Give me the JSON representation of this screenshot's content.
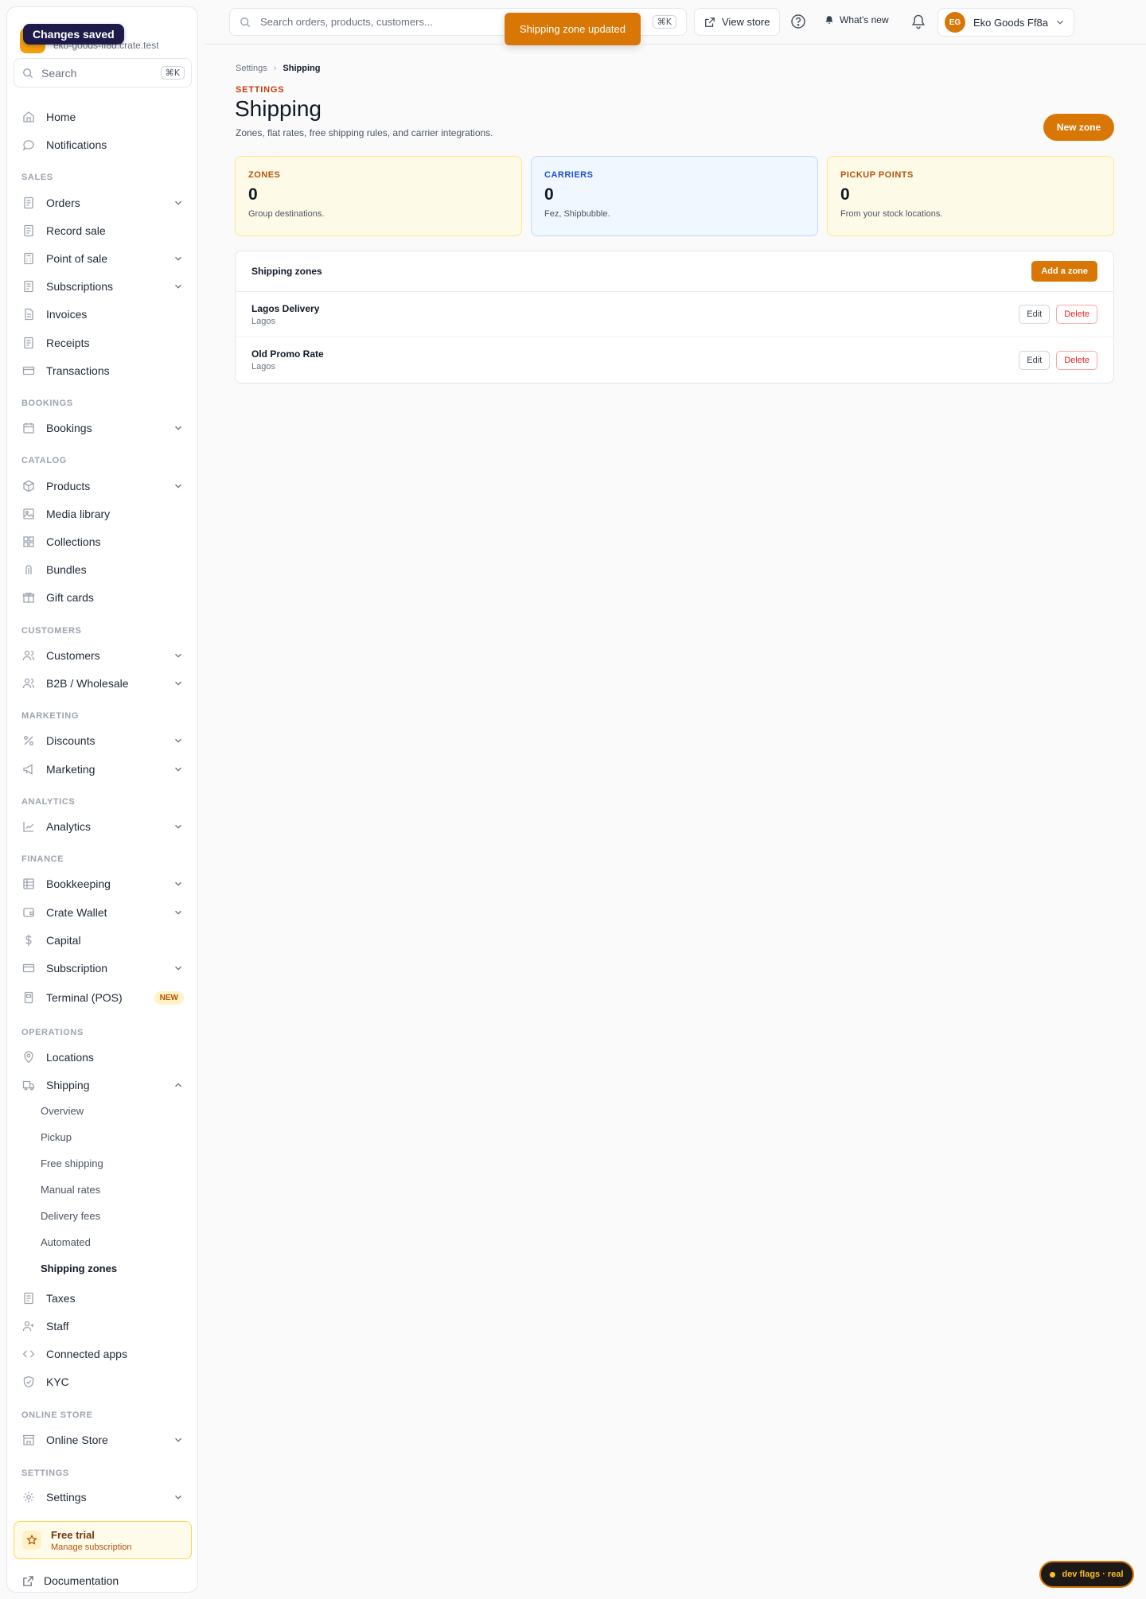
{
  "toasts": {
    "changes_saved": "Changes saved",
    "zone_updated": "Shipping zone updated"
  },
  "brand": {
    "url": "eko-goods-ff8d.crate.test"
  },
  "sidebar": {
    "search": {
      "label": "Search",
      "shortcut": "⌘K"
    },
    "items": {
      "home": "Home",
      "notifications": "Notifications",
      "orders": "Orders",
      "record_sale": "Record sale",
      "point_of_sale": "Point of sale",
      "subscriptions": "Subscriptions",
      "invoices": "Invoices",
      "receipts": "Receipts",
      "transactions": "Transactions",
      "bookings": "Bookings",
      "products": "Products",
      "media_library": "Media library",
      "collections": "Collections",
      "bundles": "Bundles",
      "gift_cards": "Gift cards",
      "customers": "Customers",
      "b2b": "B2B / Wholesale",
      "discounts": "Discounts",
      "marketing": "Marketing",
      "analytics": "Analytics",
      "bookkeeping": "Bookkeeping",
      "crate_wallet": "Crate Wallet",
      "capital": "Capital",
      "subscription": "Subscription",
      "terminal": "Terminal (POS)",
      "locations": "Locations",
      "shipping": "Shipping",
      "taxes": "Taxes",
      "staff": "Staff",
      "connected_apps": "Connected apps",
      "kyc": "KYC",
      "online_store": "Online Store",
      "settings": "Settings"
    },
    "sections": {
      "sales": "SALES",
      "bookings": "BOOKINGS",
      "catalog": "CATALOG",
      "customers": "CUSTOMERS",
      "marketing": "MARKETING",
      "analytics": "ANALYTICS",
      "finance": "FINANCE",
      "operations": "OPERATIONS",
      "online_store": "ONLINE STORE",
      "settings": "SETTINGS"
    },
    "terminal_badge": "NEW",
    "shipping_sub": {
      "overview": "Overview",
      "pickup": "Pickup",
      "free_shipping": "Free shipping",
      "manual_rates": "Manual rates",
      "delivery_fees": "Delivery fees",
      "automated": "Automated",
      "shipping_zones": "Shipping zones"
    },
    "trial": {
      "title": "Free trial",
      "link": "Manage subscription"
    },
    "documentation": "Documentation"
  },
  "topbar": {
    "search_placeholder": "Search orders, products, customers...",
    "search_shortcut": "⌘K",
    "view_store": "View store",
    "whats_new": "What's new",
    "account_initials": "EG",
    "account_name": "Eko Goods Ff8a"
  },
  "page": {
    "breadcrumb": {
      "root": "Settings",
      "current": "Shipping"
    },
    "eyebrow": "SETTINGS",
    "title": "Shipping",
    "subtitle": "Zones, flat rates, free shipping rules, and carrier integrations.",
    "new_zone": "New zone"
  },
  "stats": {
    "zones": {
      "label": "ZONES",
      "value": "0",
      "desc": "Group destinations."
    },
    "carriers": {
      "label": "CARRIERS",
      "value": "0",
      "desc": "Fez, Shipbubble."
    },
    "pickup": {
      "label": "PICKUP POINTS",
      "value": "0",
      "desc": "From your stock locations."
    }
  },
  "zones_card": {
    "title": "Shipping zones",
    "add_button": "Add a zone",
    "rows": [
      {
        "name": "Lagos Delivery",
        "location": "Lagos",
        "edit": "Edit",
        "delete": "Delete"
      },
      {
        "name": "Old Promo Rate",
        "location": "Lagos",
        "edit": "Edit",
        "delete": "Delete"
      }
    ]
  },
  "dev_flags": "dev flags · real",
  "colors": {
    "accent": "#d97706",
    "toast_dark": "#1e1b4b",
    "danger": "#dc2626"
  }
}
